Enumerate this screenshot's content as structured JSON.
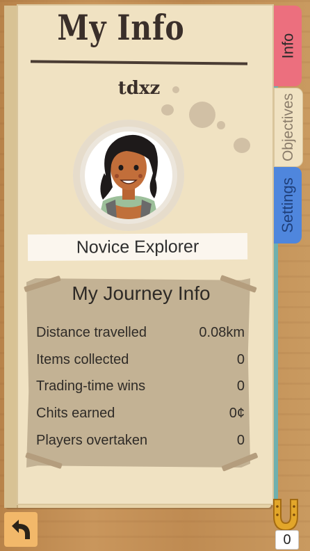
{
  "header": {
    "title": "My Info"
  },
  "profile": {
    "username": "tdxz",
    "rank": "Novice Explorer"
  },
  "journey": {
    "title": "My Journey Info",
    "rows": [
      {
        "label": "Distance travelled",
        "value": "0.08km"
      },
      {
        "label": "Items collected",
        "value": "0"
      },
      {
        "label": "Trading-time wins",
        "value": "0"
      },
      {
        "label": "Chits earned",
        "value": "0¢"
      },
      {
        "label": "Players overtaken",
        "value": "0"
      }
    ]
  },
  "tabs": [
    {
      "label": "Info",
      "active": true,
      "color": "#ec6f7e"
    },
    {
      "label": "Objectives",
      "active": false,
      "color": "#f0e2c2"
    },
    {
      "label": "Settings",
      "active": false,
      "color": "#4f86dd"
    }
  ],
  "footer": {
    "back_icon": "back-arrow-icon",
    "horseshoe_icon": "horseshoe-icon",
    "horseshoe_count": "0"
  }
}
